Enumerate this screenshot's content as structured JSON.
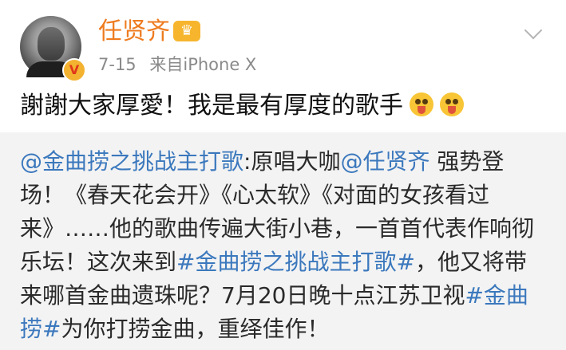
{
  "post": {
    "username": "任贤齐",
    "crown_icon": "crown-icon",
    "verified_icon": "verified-v-icon",
    "date": "7-15",
    "source": "来自iPhone X",
    "text": "謝謝大家厚愛！我是最有厚度的歌手",
    "emoji": "tongue-out-emoji"
  },
  "repost": {
    "mention1": "@金曲捞之挑战主打歌",
    "t1": ":原唱大咖",
    "mention2": "@任贤齐",
    "t2": " 强势登场！《春天花会开》《心太软》《对面的女孩看过来》……他的歌曲传遍大街小巷，一首首代表作响彻乐坛！这次来到",
    "hashtag1": "#金曲捞之挑战主打歌#",
    "t3": "，他又将带来哪首金曲遗珠呢？7月20日晚十点江苏卫视",
    "hashtag2": "#金曲捞#",
    "t4": "为你打捞金曲，重绎佳作！"
  },
  "colors": {
    "username": "#ee7b1f",
    "link": "#3b78bd",
    "repost_bg": "#f3f3f3",
    "meta": "#8a8a8a"
  }
}
